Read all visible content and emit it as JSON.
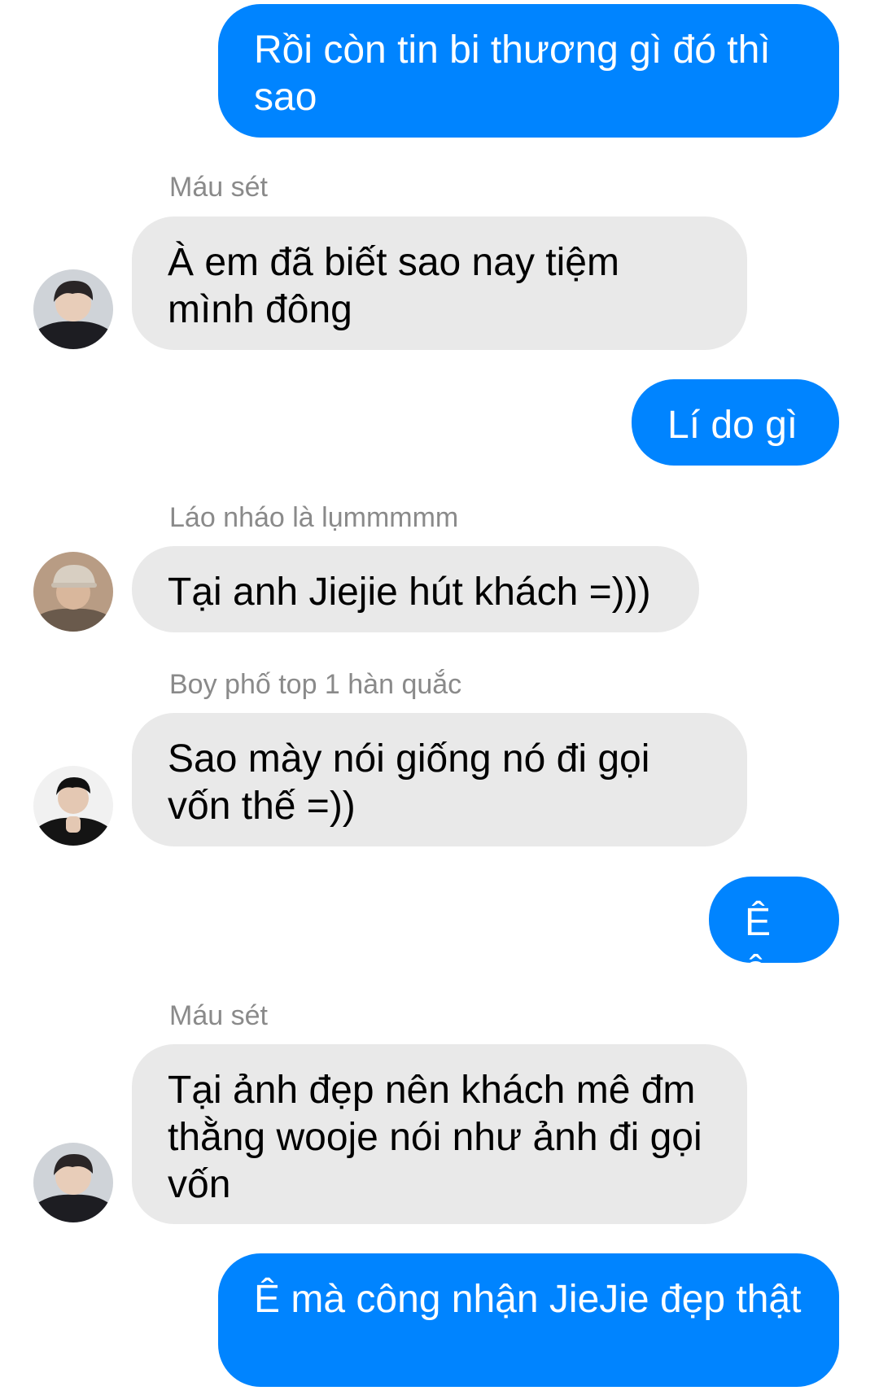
{
  "messages": [
    {
      "direction": "out",
      "text": "Rồi còn tin bi thương gì đó thì sao"
    },
    {
      "direction": "in",
      "sender": "Máu sét",
      "text": "À em đã biết sao nay tiệm mình đông",
      "avatar": "avatar-hoodie"
    },
    {
      "direction": "out",
      "text": "Lí do gì"
    },
    {
      "direction": "in",
      "sender": "Láo nháo là lụmmmmm",
      "text": "Tại anh Jiejie hút khách =)))",
      "avatar": "avatar-cap"
    },
    {
      "direction": "in",
      "sender": "Boy phố top 1 hàn quắc",
      "text": "Sao mày nói giống nó đi gọi vốn thế =))",
      "avatar": "avatar-dark"
    },
    {
      "direction": "out",
      "text": "Ê ê"
    },
    {
      "direction": "in",
      "sender": "Máu sét",
      "text": "Tại ảnh đẹp nên khách mê đm thằng wooje nói như ảnh đi gọi vốn",
      "avatar": "avatar-hoodie"
    },
    {
      "direction": "out",
      "text": "Ê mà công nhận JieJie đẹp thật"
    }
  ],
  "colors": {
    "outgoing_bubble": "#0084ff",
    "incoming_bubble": "#e9e9e9",
    "sender_name": "#8a8a8a"
  }
}
